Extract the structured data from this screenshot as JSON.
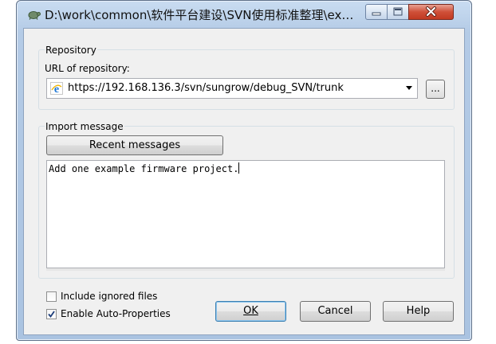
{
  "window": {
    "title": "D:\\work\\common\\软件平台建设\\SVN使用标准整理\\exa...",
    "app_icon": "tortoise-icon"
  },
  "repository": {
    "group_label": "Repository",
    "url_label": "URL of repository:",
    "url_value": "https://192.168.136.3/svn/sungrow/debug_SVN/trunk",
    "url_icon": "ie-icon",
    "browse_label": "..."
  },
  "import": {
    "group_label": "Import message",
    "recent_label": "Recent messages",
    "message": "Add one example firmware project."
  },
  "options": {
    "include_ignored": {
      "label": "Include ignored files",
      "checked": false
    },
    "auto_props": {
      "label": "Enable Auto-Properties",
      "checked": true
    }
  },
  "buttons": {
    "ok": "OK",
    "cancel": "Cancel",
    "help": "Help"
  },
  "colors": {
    "close_button": "#c13a22",
    "frame": "#b4cbe6",
    "default_button_border": "#3c7fb1"
  }
}
